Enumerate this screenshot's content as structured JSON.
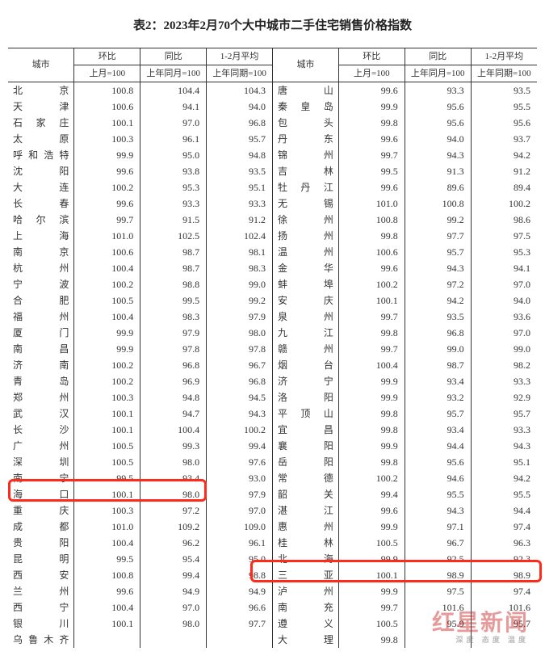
{
  "title": "表2：2023年2月70个大中城市二手住宅销售价格指数",
  "head": {
    "city": "城市",
    "mom": "环比",
    "yoy": "同比",
    "avg": "1-2月平均",
    "mom_sub": "上月=100",
    "yoy_sub": "上年同月=100",
    "avg_sub": "上年同期=100"
  },
  "chart_data": {
    "type": "table",
    "title": "表2：2023年2月70个大中城市二手住宅销售价格指数",
    "columns": [
      "城市",
      "环比(上月=100)",
      "同比(上年同月=100)",
      "1-2月平均(上年同期=100)"
    ],
    "left_rows": [
      {
        "city": "北　　京",
        "mom": "100.8",
        "yoy": "104.4",
        "avg": "104.3"
      },
      {
        "city": "天　　津",
        "mom": "100.6",
        "yoy": "94.1",
        "avg": "94.0"
      },
      {
        "city": "石 家 庄",
        "mom": "100.1",
        "yoy": "97.0",
        "avg": "96.8"
      },
      {
        "city": "太　　原",
        "mom": "100.3",
        "yoy": "96.1",
        "avg": "95.7"
      },
      {
        "city": "呼和浩特",
        "mom": "99.9",
        "yoy": "95.0",
        "avg": "94.8"
      },
      {
        "city": "沈　　阳",
        "mom": "99.6",
        "yoy": "93.8",
        "avg": "93.5"
      },
      {
        "city": "大　　连",
        "mom": "100.2",
        "yoy": "95.3",
        "avg": "95.1"
      },
      {
        "city": "长　　春",
        "mom": "99.6",
        "yoy": "93.3",
        "avg": "93.3"
      },
      {
        "city": "哈 尔 滨",
        "mom": "99.7",
        "yoy": "91.5",
        "avg": "91.2"
      },
      {
        "city": "上　　海",
        "mom": "101.0",
        "yoy": "102.5",
        "avg": "102.4"
      },
      {
        "city": "南　　京",
        "mom": "100.6",
        "yoy": "98.7",
        "avg": "98.1"
      },
      {
        "city": "杭　　州",
        "mom": "100.4",
        "yoy": "98.7",
        "avg": "98.3"
      },
      {
        "city": "宁　　波",
        "mom": "100.2",
        "yoy": "98.8",
        "avg": "99.0"
      },
      {
        "city": "合　　肥",
        "mom": "100.5",
        "yoy": "99.5",
        "avg": "99.2"
      },
      {
        "city": "福　　州",
        "mom": "100.4",
        "yoy": "98.3",
        "avg": "97.9"
      },
      {
        "city": "厦　　门",
        "mom": "99.9",
        "yoy": "97.9",
        "avg": "98.0"
      },
      {
        "city": "南　　昌",
        "mom": "99.9",
        "yoy": "97.8",
        "avg": "97.8"
      },
      {
        "city": "济　　南",
        "mom": "100.2",
        "yoy": "96.8",
        "avg": "96.7"
      },
      {
        "city": "青　　岛",
        "mom": "100.2",
        "yoy": "96.9",
        "avg": "96.8"
      },
      {
        "city": "郑　　州",
        "mom": "100.3",
        "yoy": "94.8",
        "avg": "94.5"
      },
      {
        "city": "武　　汉",
        "mom": "100.1",
        "yoy": "94.7",
        "avg": "94.3"
      },
      {
        "city": "长　　沙",
        "mom": "100.1",
        "yoy": "100.4",
        "avg": "100.2"
      },
      {
        "city": "广　　州",
        "mom": "100.5",
        "yoy": "99.3",
        "avg": "99.4"
      },
      {
        "city": "深　　圳",
        "mom": "100.5",
        "yoy": "98.0",
        "avg": "97.6"
      },
      {
        "city": "南　　宁",
        "mom": "99.5",
        "yoy": "93.4",
        "avg": "93.0"
      },
      {
        "city": "海　　口",
        "mom": "100.1",
        "yoy": "98.0",
        "avg": "97.9"
      },
      {
        "city": "重　　庆",
        "mom": "100.3",
        "yoy": "97.2",
        "avg": "97.0"
      },
      {
        "city": "成　　都",
        "mom": "101.0",
        "yoy": "109.2",
        "avg": "109.0"
      },
      {
        "city": "贵　　阳",
        "mom": "100.4",
        "yoy": "96.2",
        "avg": "96.1"
      },
      {
        "city": "昆　　明",
        "mom": "99.5",
        "yoy": "95.4",
        "avg": "95.0"
      },
      {
        "city": "西　　安",
        "mom": "100.8",
        "yoy": "99.4",
        "avg": "98.8"
      },
      {
        "city": "兰　　州",
        "mom": "99.6",
        "yoy": "94.9",
        "avg": "94.9"
      },
      {
        "city": "西　　宁",
        "mom": "100.4",
        "yoy": "97.0",
        "avg": "96.6"
      },
      {
        "city": "银　　川",
        "mom": "100.1",
        "yoy": "98.0",
        "avg": "97.7"
      },
      {
        "city": "乌鲁木齐",
        "mom": "",
        "yoy": "",
        "avg": ""
      }
    ],
    "right_rows": [
      {
        "city": "唐　　山",
        "mom": "99.6",
        "yoy": "93.3",
        "avg": "93.5"
      },
      {
        "city": "秦 皇 岛",
        "mom": "99.9",
        "yoy": "95.6",
        "avg": "95.5"
      },
      {
        "city": "包　　头",
        "mom": "99.8",
        "yoy": "95.6",
        "avg": "95.6"
      },
      {
        "city": "丹　　东",
        "mom": "99.6",
        "yoy": "94.0",
        "avg": "93.7"
      },
      {
        "city": "锦　　州",
        "mom": "99.7",
        "yoy": "94.3",
        "avg": "94.2"
      },
      {
        "city": "吉　　林",
        "mom": "99.5",
        "yoy": "91.3",
        "avg": "91.2"
      },
      {
        "city": "牡 丹 江",
        "mom": "99.6",
        "yoy": "89.6",
        "avg": "89.4"
      },
      {
        "city": "无　　锡",
        "mom": "101.0",
        "yoy": "100.8",
        "avg": "100.2"
      },
      {
        "city": "徐　　州",
        "mom": "100.8",
        "yoy": "99.2",
        "avg": "98.6"
      },
      {
        "city": "扬　　州",
        "mom": "99.8",
        "yoy": "97.7",
        "avg": "97.5"
      },
      {
        "city": "温　　州",
        "mom": "100.6",
        "yoy": "95.7",
        "avg": "95.3"
      },
      {
        "city": "金　　华",
        "mom": "99.6",
        "yoy": "94.3",
        "avg": "94.1"
      },
      {
        "city": "蚌　　埠",
        "mom": "100.2",
        "yoy": "97.2",
        "avg": "97.0"
      },
      {
        "city": "安　　庆",
        "mom": "100.1",
        "yoy": "94.2",
        "avg": "94.0"
      },
      {
        "city": "泉　　州",
        "mom": "99.7",
        "yoy": "93.5",
        "avg": "93.6"
      },
      {
        "city": "九　　江",
        "mom": "99.8",
        "yoy": "96.8",
        "avg": "97.0"
      },
      {
        "city": "赣　　州",
        "mom": "99.7",
        "yoy": "99.0",
        "avg": "99.0"
      },
      {
        "city": "烟　　台",
        "mom": "100.4",
        "yoy": "98.7",
        "avg": "98.2"
      },
      {
        "city": "济　　宁",
        "mom": "99.9",
        "yoy": "93.4",
        "avg": "93.3"
      },
      {
        "city": "洛　　阳",
        "mom": "99.9",
        "yoy": "93.2",
        "avg": "92.9"
      },
      {
        "city": "平 顶 山",
        "mom": "99.8",
        "yoy": "95.7",
        "avg": "95.7"
      },
      {
        "city": "宜　　昌",
        "mom": "99.8",
        "yoy": "93.4",
        "avg": "93.3"
      },
      {
        "city": "襄　　阳",
        "mom": "99.9",
        "yoy": "94.4",
        "avg": "94.3"
      },
      {
        "city": "岳　　阳",
        "mom": "99.8",
        "yoy": "95.6",
        "avg": "95.1"
      },
      {
        "city": "常　　德",
        "mom": "100.2",
        "yoy": "94.6",
        "avg": "94.2"
      },
      {
        "city": "韶　　关",
        "mom": "99.4",
        "yoy": "95.5",
        "avg": "95.5"
      },
      {
        "city": "湛　　江",
        "mom": "99.6",
        "yoy": "94.3",
        "avg": "94.4"
      },
      {
        "city": "惠　　州",
        "mom": "99.9",
        "yoy": "97.1",
        "avg": "97.4"
      },
      {
        "city": "桂　　林",
        "mom": "100.5",
        "yoy": "96.7",
        "avg": "96.3"
      },
      {
        "city": "北　　海",
        "mom": "99.9",
        "yoy": "92.5",
        "avg": "92.3"
      },
      {
        "city": "三　　亚",
        "mom": "100.1",
        "yoy": "98.9",
        "avg": "98.9"
      },
      {
        "city": "泸　　州",
        "mom": "99.9",
        "yoy": "97.5",
        "avg": "97.4"
      },
      {
        "city": "南　　充",
        "mom": "99.7",
        "yoy": "101.6",
        "avg": "101.6"
      },
      {
        "city": "遵　　义",
        "mom": "100.5",
        "yoy": "95.9",
        "avg": "95.7"
      },
      {
        "city": "大　　理",
        "mom": "99.8",
        "yoy": "",
        "avg": ""
      }
    ]
  },
  "watermark": {
    "main": "红星新闻",
    "sub": "深度 态度 温度"
  }
}
